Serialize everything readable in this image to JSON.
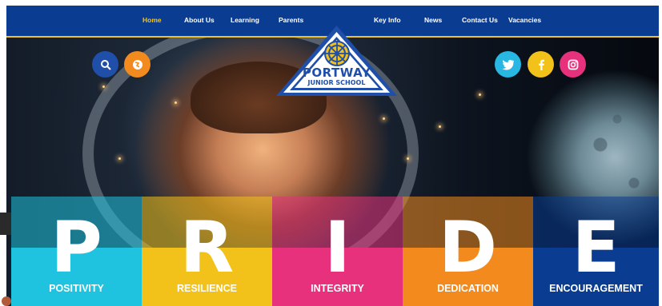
{
  "nav": {
    "items": [
      {
        "label": "Home",
        "active": true
      },
      {
        "label": "About Us",
        "active": false
      },
      {
        "label": "Learning",
        "active": false
      },
      {
        "label": "Parents",
        "active": false
      },
      {
        "label": "Key Info",
        "active": false
      },
      {
        "label": "News",
        "active": false
      },
      {
        "label": "Contact Us",
        "active": false
      },
      {
        "label": "Vacancies",
        "active": false
      }
    ],
    "background_color": "#0a3d91",
    "active_color": "#f6c417"
  },
  "logo": {
    "line1": "PORTWAY",
    "line2": "JUNIOR SCHOOL",
    "icon": "ship-wheel-icon"
  },
  "tools": [
    {
      "icon": "search-icon",
      "color": "#1f4fa8"
    },
    {
      "icon": "translate-globe-icon",
      "color": "#f28a1e"
    }
  ],
  "social": [
    {
      "icon": "twitter-icon",
      "color": "#27b7e2"
    },
    {
      "icon": "facebook-icon",
      "color": "#f2c21a"
    },
    {
      "icon": "instagram-icon",
      "color": "#e8317c"
    }
  ],
  "values": [
    {
      "letter": "P",
      "word": "POSITIVITY",
      "color": "#1fc3df"
    },
    {
      "letter": "R",
      "word": "RESILIENCE",
      "color": "#f2c21a"
    },
    {
      "letter": "I",
      "word": "INTEGRITY",
      "color": "#e8317c"
    },
    {
      "letter": "D",
      "word": "DEDICATION",
      "color": "#f28a1e"
    },
    {
      "letter": "E",
      "word": "ENCOURAGEMENT",
      "color": "#0a3d91"
    }
  ]
}
